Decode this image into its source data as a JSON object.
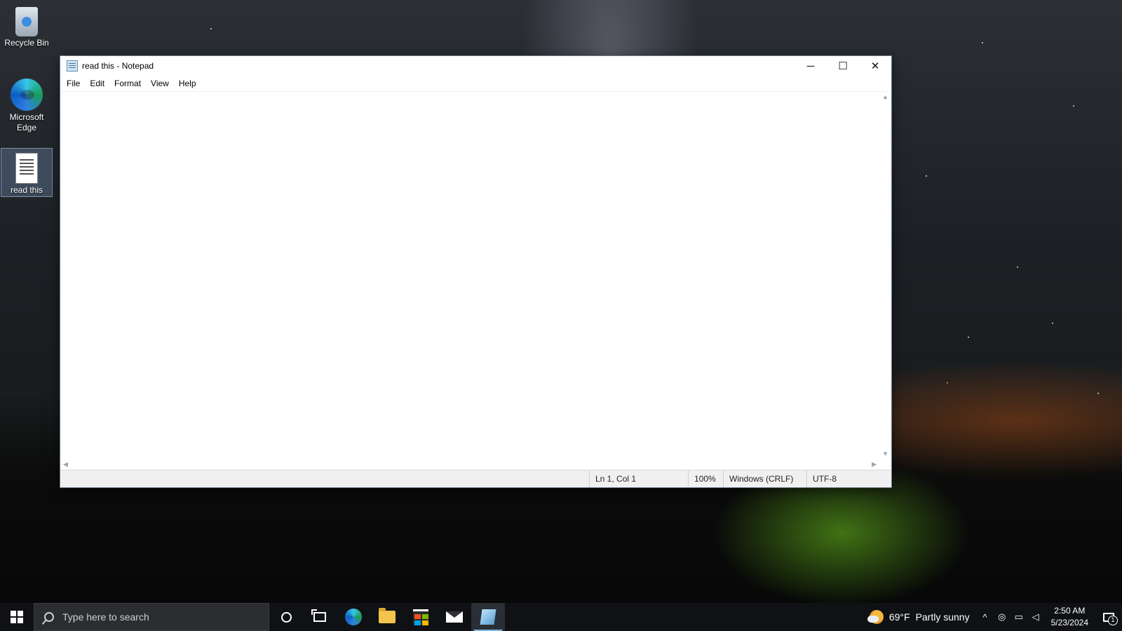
{
  "desktop": {
    "icons": [
      {
        "label": "Recycle Bin",
        "icon": "recycle-bin-icon"
      },
      {
        "label": "Microsoft Edge",
        "icon": "edge-icon"
      },
      {
        "label": "read this",
        "icon": "text-file-icon"
      }
    ]
  },
  "window": {
    "title": "read this - Notepad",
    "controls": {
      "minimize": "─",
      "maximize": "☐",
      "close": "✕"
    },
    "menu": [
      "File",
      "Edit",
      "Format",
      "View",
      "Help"
    ],
    "content": "",
    "status": {
      "position": "Ln 1, Col 1",
      "zoom": "100%",
      "line_ending": "Windows (CRLF)",
      "encoding": "UTF-8"
    }
  },
  "taskbar": {
    "search_placeholder": "Type here to search",
    "pinned": [
      "start-icon",
      "cortana-icon",
      "task-view-icon",
      "edge-icon",
      "file-explorer-icon",
      "store-icon",
      "mail-icon",
      "notepad-icon"
    ],
    "active_app": "notepad-icon",
    "weather": {
      "temp": "69°F",
      "condition": "Partly sunny"
    },
    "tray_chevron": "^",
    "clock": {
      "time": "2:50 AM",
      "date": "5/23/2024"
    },
    "notification_count": "1"
  },
  "colors": {
    "accent": "#76b9ed",
    "taskbar": "#0f1114"
  }
}
